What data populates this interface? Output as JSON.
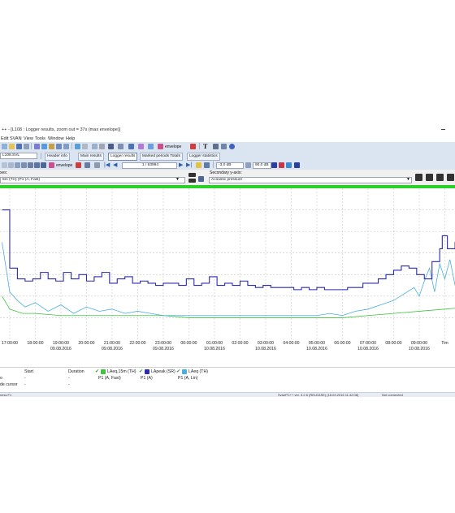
{
  "window": {
    "title": "++ - [L108 : Logger results, zoom out = 37s (max envelope)]"
  },
  "menu": [
    "Edit",
    "SVAN",
    "View",
    "Tools",
    "Window",
    "Help"
  ],
  "toolbar1": {
    "envelope_label": "envelope"
  },
  "toolbar2": {
    "file_name": "L108.SVL",
    "tabs": [
      "Header info",
      "Main results",
      "Logger results",
      "Marked periods Totals",
      "Logger statistics"
    ]
  },
  "toolbar3": {
    "envelope_label": "envelope",
    "position": "1 / 63994",
    "db_low": "-3,0 dB",
    "db_high": "90,0 dB"
  },
  "axes": {
    "primary_label": "xes:",
    "primary_value": "5m (TH) (P1 (A, Fast)",
    "secondary_label": "Secondary y-axis:",
    "secondary_value": "Acoustic pressure"
  },
  "chart_data": {
    "type": "line",
    "x_ticks": [
      {
        "time": "17:00:00",
        "date": ""
      },
      {
        "time": "18:00:00",
        "date": ""
      },
      {
        "time": "19:00:00",
        "date": "09.08.2016"
      },
      {
        "time": "20:00:00",
        "date": ""
      },
      {
        "time": "21:00:00",
        "date": "09.08.2016"
      },
      {
        "time": "22:00:00",
        "date": ""
      },
      {
        "time": "23:00:00",
        "date": "09.08.2016"
      },
      {
        "time": "00:00:00",
        "date": ""
      },
      {
        "time": "01:00:00",
        "date": "10.08.2016"
      },
      {
        "time": "02:00:00",
        "date": ""
      },
      {
        "time": "03:00:00",
        "date": "10.08.2016"
      },
      {
        "time": "04:00:00",
        "date": ""
      },
      {
        "time": "05:00:00",
        "date": "10.08.2016"
      },
      {
        "time": "06:00:00",
        "date": ""
      },
      {
        "time": "07:00:00",
        "date": "10.08.2016"
      },
      {
        "time": "08:00:00",
        "date": ""
      },
      {
        "time": "09:00:00",
        "date": "10.08.2016"
      },
      {
        "time": "Tim",
        "date": ""
      }
    ],
    "series": [
      {
        "name": "LApeak (SR)",
        "color": "#2b2bb0",
        "x": [
          16.7,
          17.0,
          17.3,
          17.6,
          17.9,
          18.2,
          18.5,
          18.8,
          19.1,
          19.4,
          19.7,
          20.0,
          20.3,
          20.6,
          20.9,
          21.2,
          21.5,
          21.8,
          22.1,
          22.4,
          22.7,
          23.0,
          23.3,
          23.6,
          23.9,
          24.2,
          24.5,
          24.8,
          25.1,
          25.4,
          25.7,
          26.0,
          26.3,
          26.6,
          26.9,
          27.2,
          27.5,
          27.8,
          28.1,
          28.4,
          28.7,
          29.0,
          29.3,
          29.6,
          29.9,
          30.2,
          30.5,
          30.8,
          31.1,
          31.4,
          31.7,
          32.0,
          32.3,
          32.6,
          32.9,
          33.2,
          33.5,
          33.8,
          33.9,
          34.1,
          34.4,
          34.7,
          35.0
        ],
        "y": [
          60,
          33,
          28,
          27,
          28,
          31,
          28,
          27,
          31,
          28,
          30,
          27,
          29,
          31,
          26,
          28,
          29,
          26,
          27,
          26,
          25,
          26,
          26,
          25,
          28,
          25,
          26,
          29,
          25,
          26,
          25,
          27,
          25,
          24,
          25,
          24,
          24,
          24,
          23,
          24,
          23,
          24,
          23,
          23,
          23,
          24,
          24,
          26,
          26,
          28,
          30,
          32,
          34,
          33,
          30,
          28,
          36,
          42,
          48,
          42,
          45,
          39,
          44
        ]
      },
      {
        "name": "LAeq,15m (TH)",
        "color": "#3cc43c",
        "x": [
          16.7,
          17.0,
          17.5,
          18.0,
          19.0,
          20.0,
          21.0,
          22.0,
          23.0,
          24.0,
          25.0,
          26.0,
          27.0,
          28.0,
          29.0,
          30.0,
          31.0,
          32.0,
          33.0,
          34.0,
          35.0
        ],
        "y": [
          20,
          14,
          12,
          12,
          11,
          11,
          11,
          11,
          11,
          10,
          10,
          10,
          10,
          10,
          10,
          10,
          11,
          12,
          13,
          14,
          15
        ]
      },
      {
        "name": "LAeq (TH)",
        "color": "#49aede",
        "x": [
          16.7,
          17.0,
          17.3,
          17.6,
          18.0,
          18.5,
          19.0,
          19.5,
          20.0,
          20.5,
          21.0,
          21.5,
          22.0,
          22.5,
          23.0,
          24.0,
          25.0,
          26.0,
          27.0,
          28.0,
          29.0,
          29.5,
          30.0,
          30.5,
          31.0,
          31.5,
          32.0,
          32.4,
          32.8,
          33.0,
          33.2,
          33.4,
          33.6,
          33.8,
          34.0,
          34.2,
          34.4,
          34.6,
          34.8,
          35.0
        ],
        "y": [
          45,
          22,
          18,
          15,
          17,
          13,
          16,
          12,
          15,
          13,
          14,
          12,
          13,
          12,
          11,
          11,
          11,
          11,
          11,
          11,
          11,
          12,
          11,
          13,
          14,
          16,
          18,
          21,
          24,
          20,
          27,
          33,
          22,
          35,
          28,
          37,
          25,
          33,
          23,
          30
        ]
      }
    ],
    "legend": [
      {
        "label": "LAeq,15m (TH)",
        "color": "#3cc43c"
      },
      {
        "label": "LApeak (SR)",
        "color": "#2b2bb0"
      },
      {
        "label": "LAeq (TH)",
        "color": "#49aede"
      }
    ],
    "ylim": [
      0,
      70
    ],
    "grid": true
  },
  "info": {
    "headers": [
      "Start",
      "Duration"
    ],
    "row1": [
      "-",
      "-",
      "P1 (A, Fast)",
      "P1 (A)",
      "P1 (A, Lin)"
    ],
    "row2_label": "de cursor",
    "row2": [
      "-",
      "-"
    ]
  },
  "status": {
    "left": "ness F1",
    "version": "SvanPC++ ver. 3.2.6 (RELEASE) (18.03.2016 11:42:08)",
    "connection": "Not connected"
  }
}
